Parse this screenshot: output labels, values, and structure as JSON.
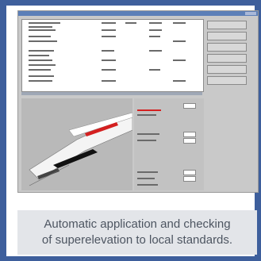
{
  "caption": {
    "line1": "Automatic application and checking",
    "line2": "of superelevation to local standards."
  },
  "colors": {
    "frame": "#3e5f9c",
    "caption_bg": "#e3e5e9",
    "caption_text": "#4d5561",
    "window_bg": "#c9c9c9",
    "highlight": "#d42020"
  }
}
